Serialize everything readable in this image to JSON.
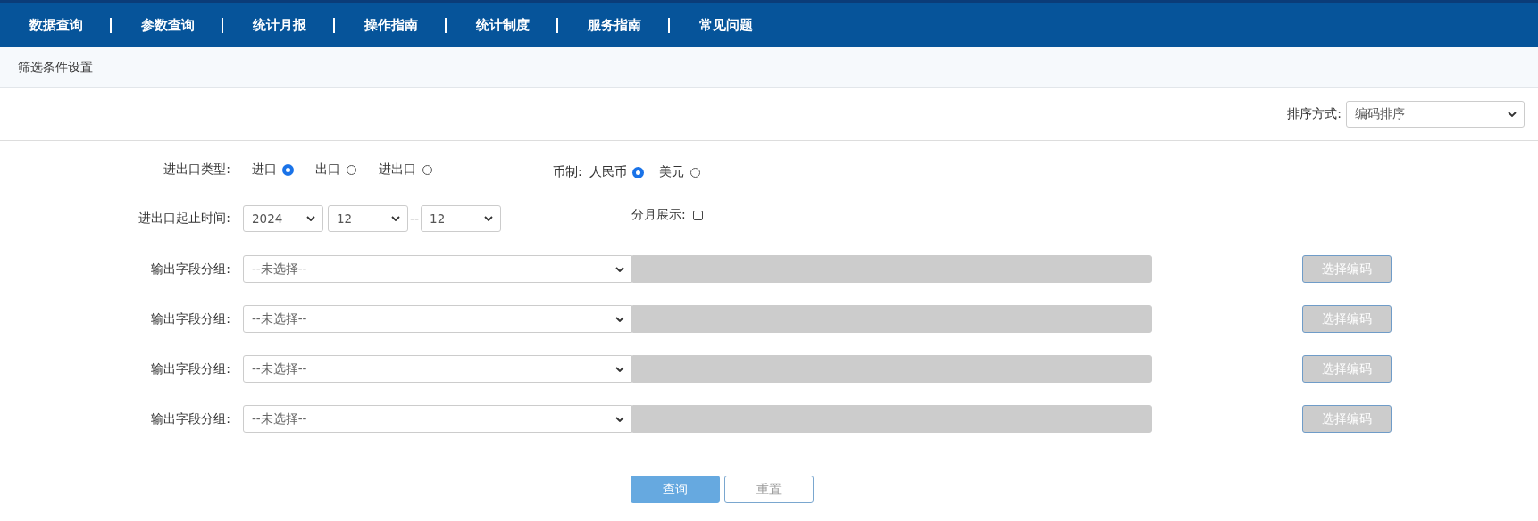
{
  "nav": [
    {
      "label": "数据查询"
    },
    {
      "label": "参数查询"
    },
    {
      "label": "统计月报"
    },
    {
      "label": "操作指南"
    },
    {
      "label": "统计制度"
    },
    {
      "label": "服务指南"
    },
    {
      "label": "常见问题"
    }
  ],
  "panel": {
    "title": "筛选条件设置"
  },
  "sort": {
    "label": "排序方式:",
    "value": "编码排序"
  },
  "trade_type": {
    "label": "进出口类型:",
    "options": [
      {
        "label": "进口",
        "selected": true
      },
      {
        "label": "出口",
        "selected": false
      },
      {
        "label": "进出口",
        "selected": false
      }
    ]
  },
  "currency": {
    "label": "币制:",
    "options": [
      {
        "label": "人民币",
        "selected": true
      },
      {
        "label": "美元",
        "selected": false
      }
    ]
  },
  "period": {
    "label": "进出口起止时间:",
    "year": "2024",
    "from_month": "12",
    "separator": "--",
    "to_month": "12"
  },
  "monthly": {
    "label": "分月展示:",
    "checked": false
  },
  "groups": [
    {
      "label": "输出字段分组:",
      "value": "--未选择--",
      "code_disabled": true,
      "button": "选择编码"
    },
    {
      "label": "输出字段分组:",
      "value": "--未选择--",
      "code_disabled": true,
      "button": "选择编码"
    },
    {
      "label": "输出字段分组:",
      "value": "--未选择--",
      "code_disabled": true,
      "button": "选择编码"
    },
    {
      "label": "输出字段分组:",
      "value": "--未选择--",
      "code_disabled": true,
      "button": "选择编码"
    }
  ],
  "actions": [
    {
      "label": "查询",
      "kind": "primary"
    },
    {
      "label": "重置",
      "kind": "secondary"
    }
  ]
}
